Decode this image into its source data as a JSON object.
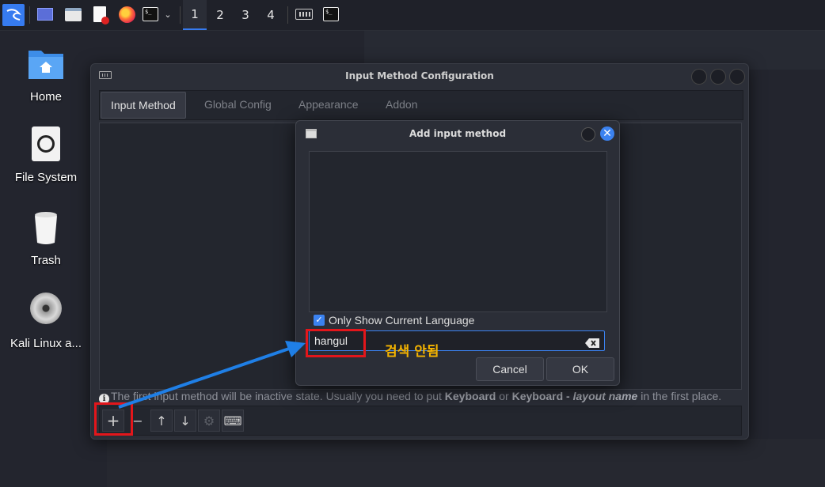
{
  "panel": {
    "workspaces": [
      "1",
      "2",
      "3",
      "4"
    ],
    "active_workspace": "1",
    "icons": [
      "kali-menu-icon",
      "desktop-icon",
      "file-manager-icon",
      "text-editor-icon",
      "firefox-icon",
      "terminal-icon",
      "chevron-down-icon",
      "keyboard-icon",
      "terminal-icon"
    ],
    "terminal_prompt": "$_"
  },
  "desktop": {
    "icons": [
      {
        "label": "Home",
        "icon": "home-folder-icon"
      },
      {
        "label": "File System",
        "icon": "drive-icon"
      },
      {
        "label": "Trash",
        "icon": "trash-icon"
      },
      {
        "label": "Kali Linux a...",
        "icon": "disc-icon"
      }
    ]
  },
  "main_window": {
    "title": "Input Method Configuration",
    "tabs": [
      "Input Method",
      "Global Config",
      "Appearance",
      "Addon"
    ],
    "active_tab": "Input Method",
    "info": {
      "part1": "The first input method will be inactive state. Usually you need to put ",
      "bold1": "Keyboard",
      "part2": " or ",
      "bold2": "Keyboard - ",
      "bold_italic": "layout name",
      "part3": " in the first place."
    },
    "toolbar_glyphs": {
      "add": "+",
      "remove": "−",
      "up": "↑",
      "down": "↓",
      "configure": "⚙",
      "keyboard": "⌨"
    }
  },
  "dialog": {
    "title": "Add input method",
    "checkbox_label": "Only Show Current Language",
    "checkbox_checked": true,
    "search_value": "hangul",
    "cancel_label": "Cancel",
    "ok_label": "OK"
  },
  "annotation": {
    "text": "검색 안됨",
    "highlight_color": "#e3161b",
    "arrow_color": "#1f7fe6",
    "text_color": "#f5b400"
  },
  "colors": {
    "accent": "#367bf0",
    "window_bg": "#2b2e37",
    "desktop_bg": "#23252e"
  }
}
